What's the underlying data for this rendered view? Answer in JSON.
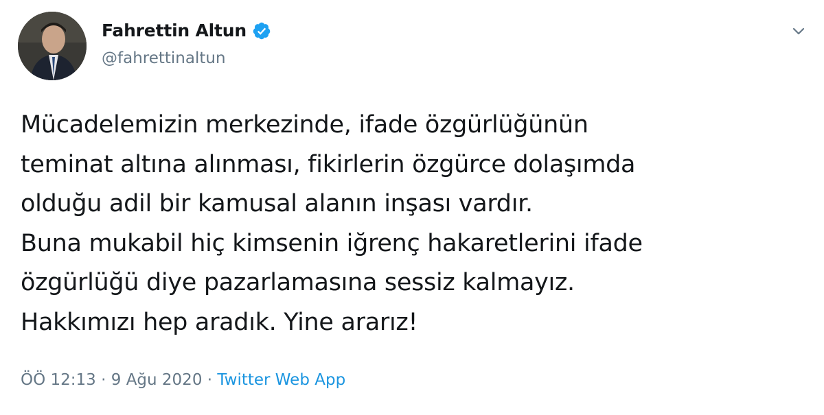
{
  "author": {
    "display_name": "Fahrettin Altun",
    "handle": "@fahrettinaltun",
    "verified_icon": "verified-badge-icon"
  },
  "tweet": {
    "lines": [
      "Mücadelemizin merkezinde, ifade özgürlüğünün",
      "teminat altına alınması, fikirlerin özgürce dolaşımda",
      "olduğu adil bir kamusal alanın inşası vardır.",
      "Buna mukabil hiç kimsenin iğrenç hakaretlerini ifade",
      "özgürlüğü diye pazarlamasına sessiz kalmayız.",
      "Hakkımızı hep aradık. Yine ararız!"
    ]
  },
  "meta": {
    "time": "ÖÖ 12:13",
    "separator1": " · ",
    "date": "9 Ağu 2020",
    "separator2": " · ",
    "source": "Twitter Web App"
  },
  "colors": {
    "text": "#14171a",
    "secondary": "#657786",
    "link": "#1b95e0",
    "verified": "#1da1f2"
  }
}
